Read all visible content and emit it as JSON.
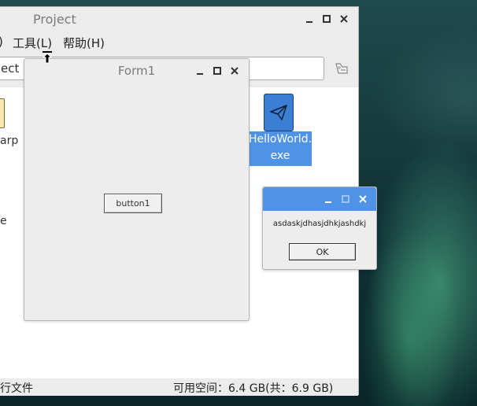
{
  "file_manager": {
    "title": "Project",
    "menu": {
      "partial_left": ")",
      "tools": "工具(L)",
      "help": "帮助(H)"
    },
    "path_partial": "ect",
    "items": [
      {
        "label_partial": "arp"
      },
      {
        "label_partial": "e"
      },
      {
        "label": "HelloWorld.\nexe",
        "label_line1": "HelloWorld.",
        "label_line2": "exe"
      }
    ],
    "status_left": "行文件",
    "status_right": "可用空间：6.4 GB(共：6.9 GB)"
  },
  "form1": {
    "title": "Form1",
    "button_label": "button1"
  },
  "message_box": {
    "text": "asdaskjdhasjdhkjashdkj",
    "ok_label": "OK"
  },
  "colors": {
    "selection_blue": "#4f93e6",
    "exe_icon_blue": "#3b7ed6",
    "window_bg": "#ececec"
  },
  "icons": {
    "minimize": "minimize-icon",
    "maximize": "maximize-icon",
    "close": "close-icon",
    "go": "go-icon",
    "exe": "paper-plane-icon",
    "cursor": "resize-cursor-icon"
  }
}
